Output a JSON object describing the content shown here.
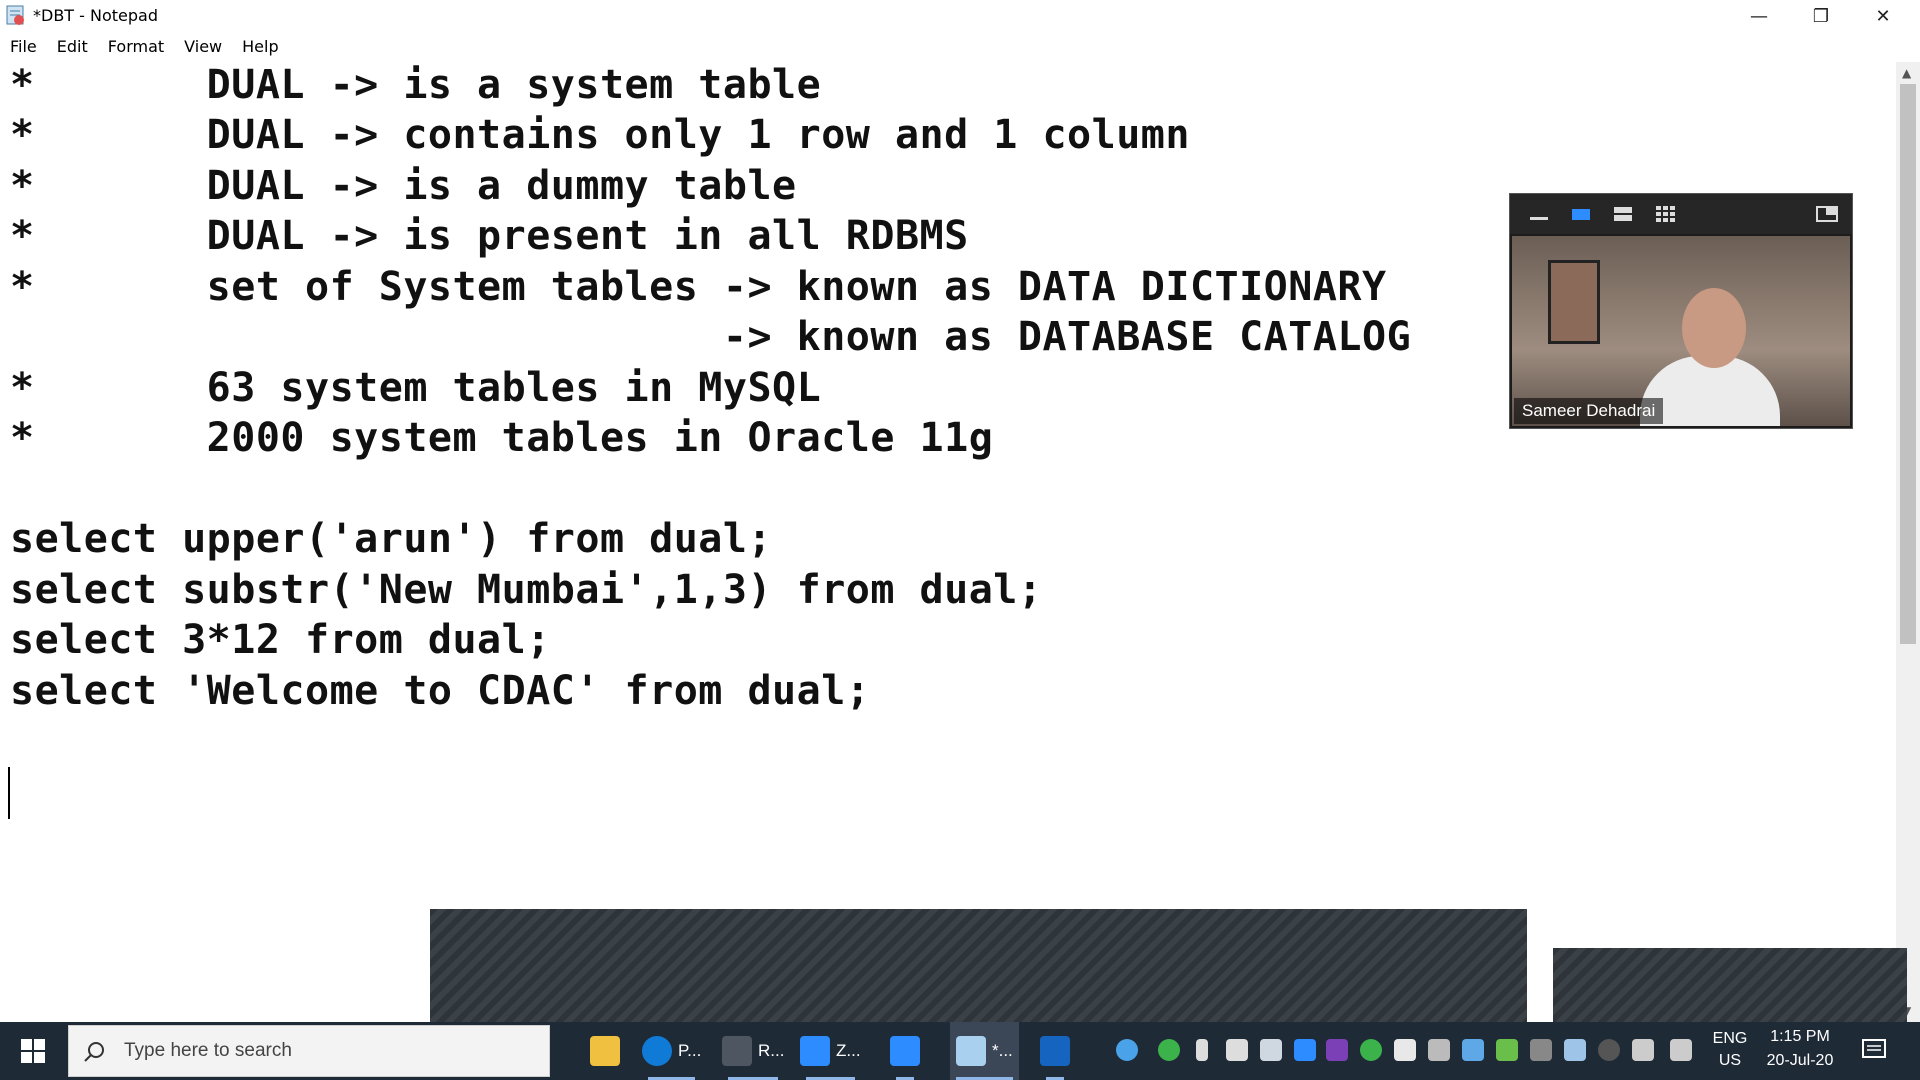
{
  "window": {
    "title": "*DBT - Notepad"
  },
  "menu": [
    "File",
    "Edit",
    "Format",
    "View",
    "Help"
  ],
  "editor": {
    "lines": [
      "*       DUAL -> is a system table",
      "*       DUAL -> contains only 1 row and 1 column",
      "*       DUAL -> is a dummy table",
      "*       DUAL -> is present in all RDBMS",
      "*       set of System tables -> known as DATA DICTIONARY",
      "                             -> known as DATABASE CATALOG",
      "*       63 system tables in MySQL",
      "*       2000 system tables in Oracle 11g",
      "",
      "select upper('arun') from dual;",
      "select substr('New Mumbai',1,3) from dual;",
      "select 3*12 from dual;",
      "select 'Welcome to CDAC' from dual;"
    ]
  },
  "video": {
    "participant_name": "Sameer Dehadrai"
  },
  "taskbar": {
    "search_placeholder": "Type here to search",
    "apps": [
      {
        "icon": "file-explorer-icon",
        "label": ""
      },
      {
        "icon": "edge-icon",
        "label": "P..."
      },
      {
        "icon": "sql-app-icon",
        "label": "R..."
      },
      {
        "icon": "zoom-icon",
        "label": "Z..."
      },
      {
        "icon": "zoom-meeting-icon",
        "label": ""
      },
      {
        "icon": "notepad-icon",
        "label": "*..."
      },
      {
        "icon": "whiteboard-icon",
        "label": ""
      }
    ],
    "language": "ENG",
    "region": "US",
    "time": "1:15 PM",
    "date": "20-Jul-20"
  },
  "colors": {
    "taskbar_bg": "#1f2a37",
    "zoom_blue": "#2d8cff",
    "edge_blue": "#0f7bd6"
  }
}
